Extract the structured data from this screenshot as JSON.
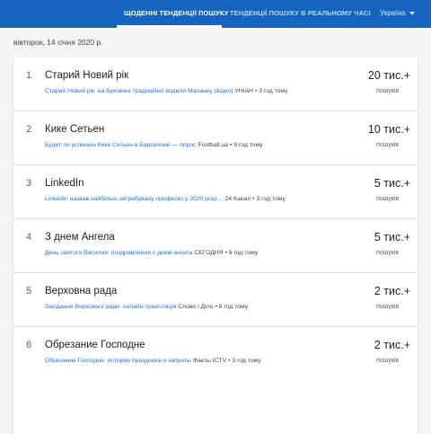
{
  "nav": {
    "tabs": [
      {
        "label": "ЩОДЕННІ ТЕНДЕНЦІЇ ПОШУКУ",
        "active": true
      },
      {
        "label": "ТЕНДЕНЦІЇ ПОШУКУ В РЕАЛЬНОМУ ЧАСІ",
        "active": false
      }
    ],
    "country": "Україна",
    "accent_color": "#1565c0"
  },
  "date": "вівторок, 14 січня 2020 р.",
  "trends": [
    {
      "rank": "1",
      "title": "Старий Новий рік",
      "article_title": "Старий Новий рік: на Буковині традиційно водили Маланку (відео)",
      "article_meta": "УНІАН • 3 год тому",
      "count": "20 тис.+",
      "count_label": "пошуків"
    },
    {
      "rank": "2",
      "title": "Кике Сетьен",
      "article_title": "Будет ли успешен Кике Сетьен в Барселоне — опрос",
      "article_meta": "Football.ua • 9 год тому",
      "count": "10 тис.+",
      "count_label": "пошуків"
    },
    {
      "rank": "3",
      "title": "LinkedIn",
      "article_title": "LinkedIn назвав найбільш затребувану професію у 2020 році ...",
      "article_meta": "24 Канал • 3 год тому",
      "count": "5 тис.+",
      "count_label": "пошуків"
    },
    {
      "rank": "4",
      "title": "З днем Ангела",
      "article_title": "День святого Василия: поздравления с днем ангела",
      "article_meta": "СЕГОДНЯ • 9 год тому",
      "count": "5 тис.+",
      "count_label": "пошуків"
    },
    {
      "rank": "5",
      "title": "Верховна рада",
      "article_title": "Засідання Верховної ради: онлайн-трансляція",
      "article_meta": "Слово і Діло • 6 год тому",
      "count": "2 тис.+",
      "count_label": "пошуків"
    },
    {
      "rank": "6",
      "title": "Обрезание Господне",
      "article_title": "Обрезание Господне: история праздника и запреты",
      "article_meta": "Факты ICTV • 3 год тому",
      "count": "2 тис.+",
      "count_label": "пошуків"
    }
  ]
}
